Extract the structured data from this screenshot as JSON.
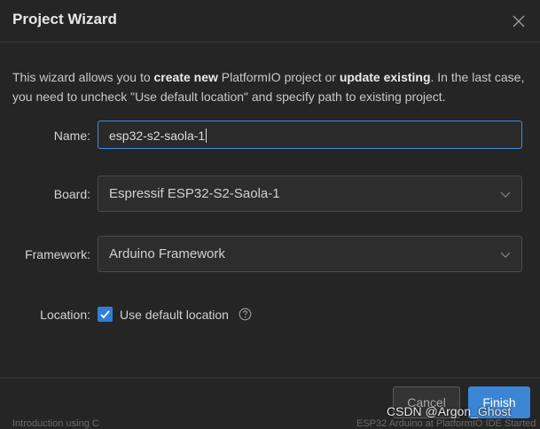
{
  "dialog": {
    "title": "Project Wizard",
    "intro": {
      "part1": "This wizard allows you to ",
      "bold1": "create new",
      "part2": " PlatformIO project or ",
      "bold2": "update existing",
      "part3": ". In the last case, you need to uncheck \"Use default location\" and specify path to existing project."
    },
    "name": {
      "label": "Name:",
      "value": "esp32-s2-saola-1"
    },
    "board": {
      "label": "Board:",
      "value": "Espressif ESP32-S2-Saola-1"
    },
    "framework": {
      "label": "Framework:",
      "value": "Arduino Framework"
    },
    "location": {
      "label": "Location:",
      "checkbox_label": "Use default location",
      "checked": true
    },
    "buttons": {
      "cancel": "Cancel",
      "finish": "Finish"
    }
  },
  "background": {
    "left_snippet": "Introduction using C",
    "right_snippet": "ESP32 Arduino at PlatformIO IDE Started"
  },
  "watermark": "CSDN @Argon_Ghost",
  "colors": {
    "accent": "#3b86d4",
    "dialog_bg": "#252526",
    "focus_border": "#3e8ed8"
  },
  "icons": {
    "close": "close-icon",
    "chevron": "chevron-down-icon",
    "check": "check-icon",
    "help": "help-circle-icon"
  }
}
